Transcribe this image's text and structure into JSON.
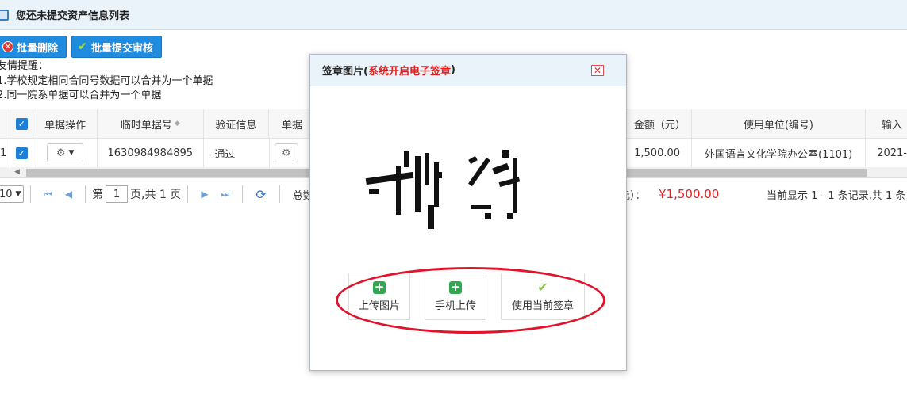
{
  "title": "您还未提交资产信息列表",
  "toolbar": {
    "delete_label": "批量删除",
    "submit_label": "批量提交审核"
  },
  "tips": {
    "heading": "友情提醒：",
    "line1": "1.学校规定相同合同号数据可以合并为一个单据",
    "line2": "2.同一院系单据可以合并为一个单据"
  },
  "table": {
    "headers": [
      "单据操作",
      "临时单据号",
      "验证信息",
      "单据",
      "金额（元）",
      "使用单位(编号)",
      "输入"
    ],
    "row": {
      "index": "1",
      "temp_no": "1630984984895",
      "verify": "通过",
      "amount": "1,500.00",
      "unit": "外国语言文化学院办公室(1101)",
      "input": "2021-"
    }
  },
  "pager": {
    "page_size": "10",
    "page_prefix": "第",
    "page_value": "1",
    "page_suffix": "页,共 1 页",
    "total_label": "总数",
    "amount_label": "元）：",
    "amount_value": "¥1,500.00",
    "summary": "当前显示 1 - 1 条记录,共 1 条"
  },
  "modal": {
    "title_prefix": "签章图片(",
    "title_highlight": "系统开启电子签章",
    "title_suffix": ")",
    "actions": {
      "upload_label": "上传图片",
      "mobile_label": "手机上传",
      "use_label": "使用当前签章"
    }
  },
  "colors": {
    "accent": "#1f8ce0",
    "highlight": "#e02020",
    "annotation": "#e3122a"
  }
}
